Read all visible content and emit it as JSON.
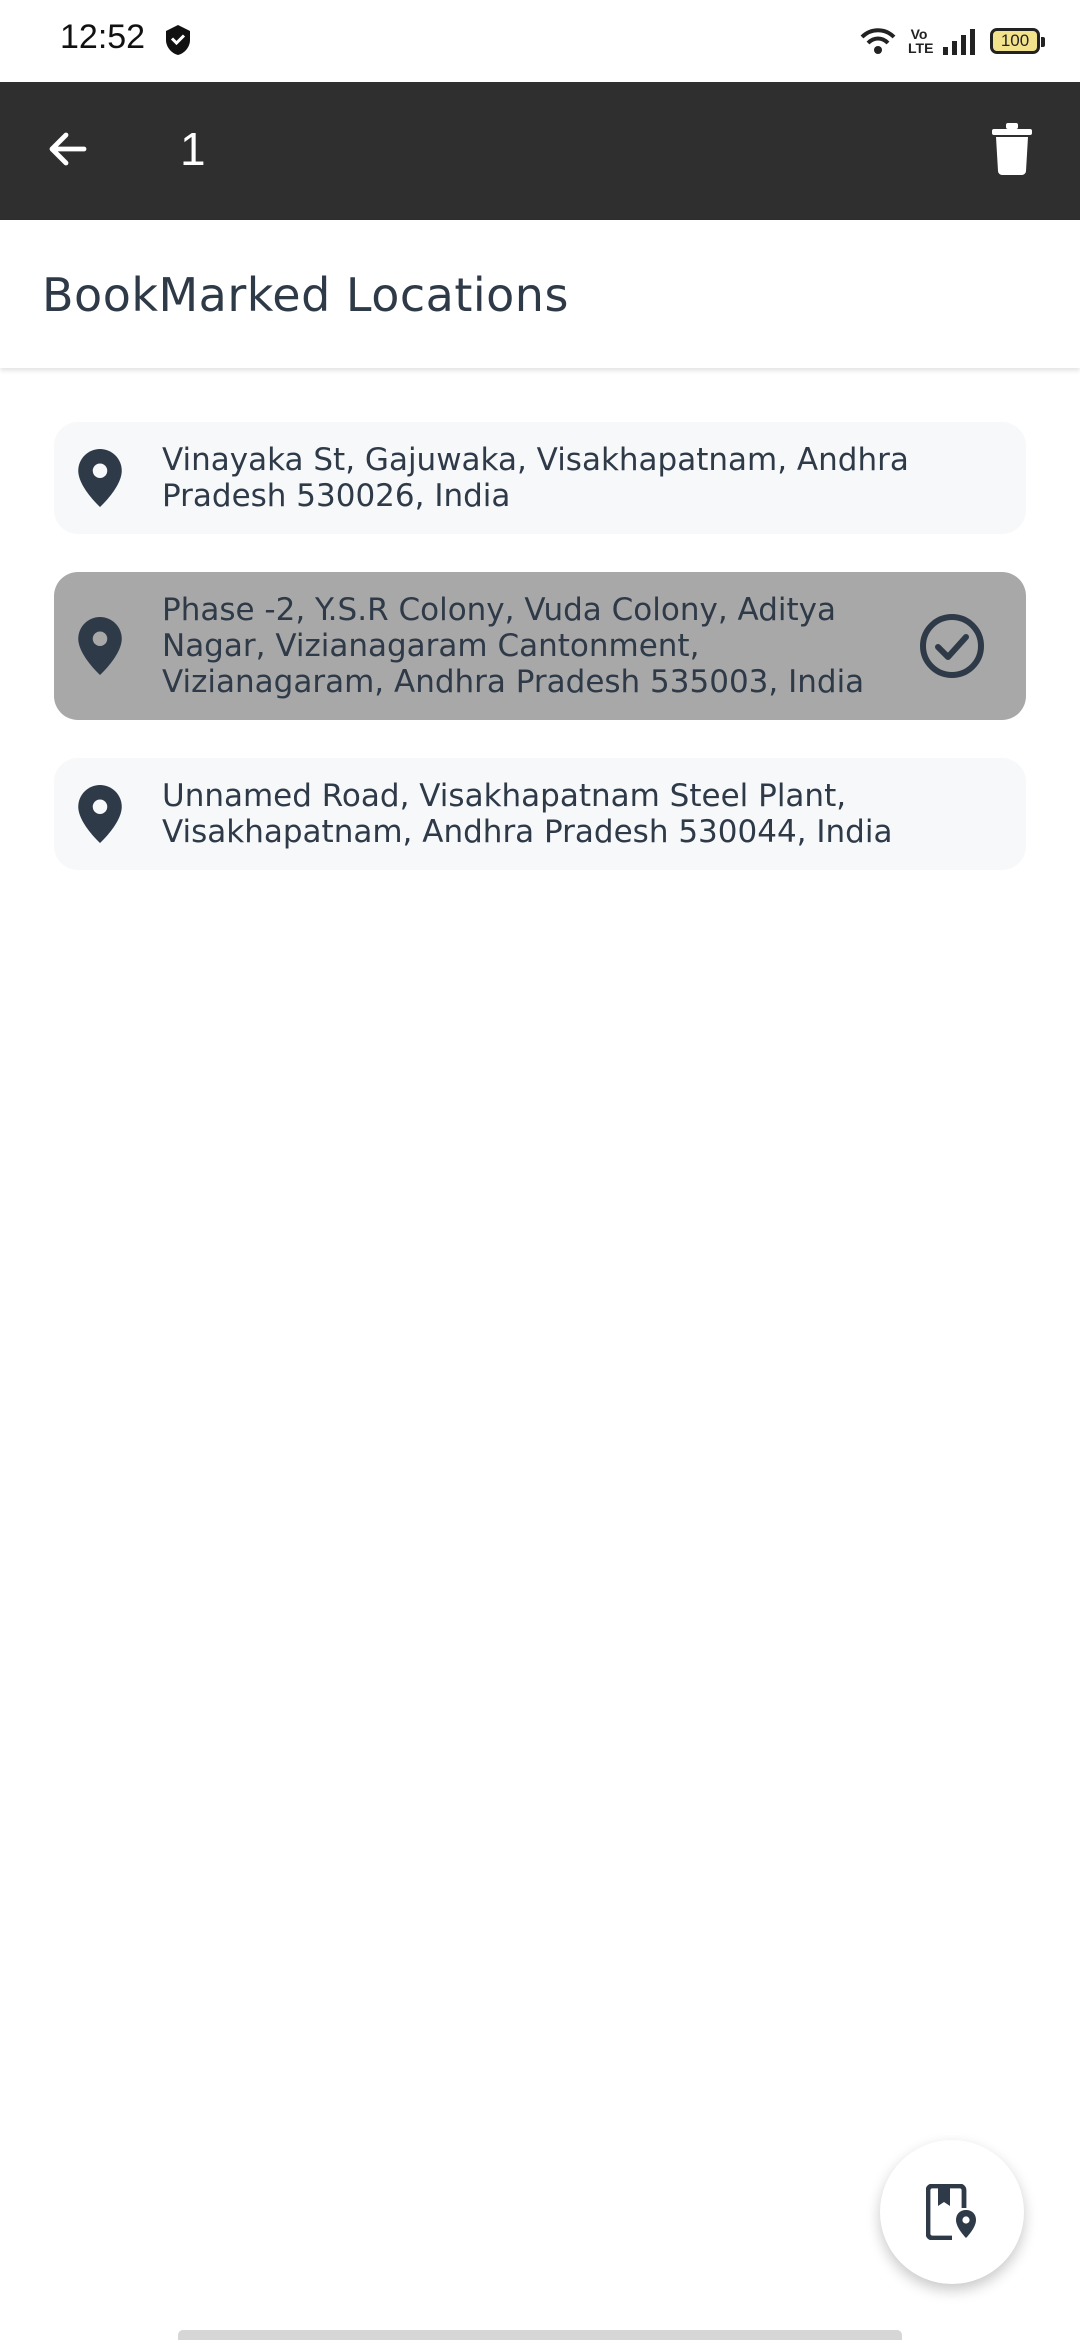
{
  "status_bar": {
    "time": "12:52",
    "network_label": "Vo LTE",
    "battery": "100",
    "app_icon": "shield-icon"
  },
  "app_bar": {
    "selected_count": "1",
    "back_icon": "arrow-back-icon",
    "delete_icon": "trash-icon"
  },
  "page": {
    "title": "BookMarked Locations"
  },
  "locations": [
    {
      "address": "Vinayaka St, Gajuwaka, Visakhapatnam, Andhra Pradesh 530026, India",
      "selected": false
    },
    {
      "address": "Phase -2, Y.S.R Colony, Vuda Colony, Aditya Nagar, Vizianagaram Cantonment, Vizianagaram, Andhra Pradesh 535003, India",
      "selected": true
    },
    {
      "address": "Unnamed Road, Visakhapatnam Steel Plant, Visakhapatnam, Andhra Pradesh 530044, India",
      "selected": false
    }
  ],
  "fab": {
    "icon": "bookmark-location-icon"
  },
  "colors": {
    "app_bar": "#2f2f2f",
    "text": "#2f3a48",
    "item_bg": "#f7f8fa",
    "item_selected_bg": "#a8a8a8"
  }
}
